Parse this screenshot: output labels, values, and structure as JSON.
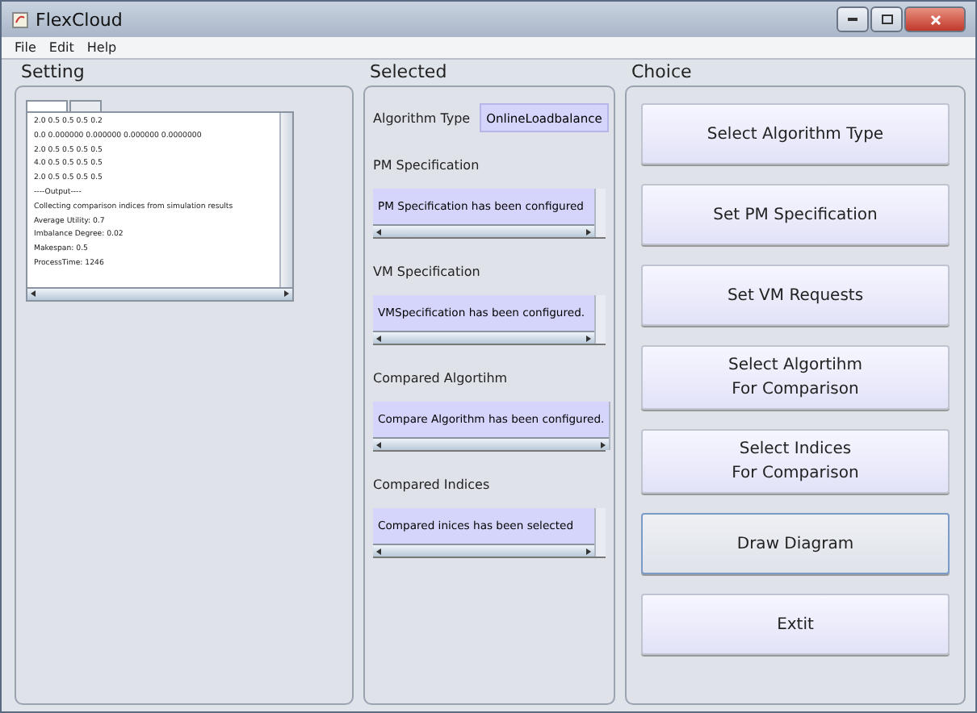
{
  "window": {
    "title": "FlexCloud"
  },
  "menu": [
    "File",
    "Edit",
    "Help"
  ],
  "setting": {
    "heading": "Setting",
    "tabs": [
      {
        "selected": true
      },
      {
        "selected": false
      }
    ],
    "log": [
      "2.0 0.5 0.5 0.5 0.2",
      "0.0 0.000000 0.000000 0.000000 0.0000000",
      "2.0 0.5 0.5 0.5 0.5",
      "4.0 0.5 0.5 0.5 0.5",
      "2.0 0.5 0.5 0.5 0.5",
      "----Output----",
      "Collecting comparison indices from simulation results",
      "Average Utility: 0.7",
      "Imbalance Degree: 0.02",
      "Makespan: 0.5",
      "ProcessTime: 1246"
    ]
  },
  "selected": {
    "heading": "Selected",
    "algorithm_type": {
      "label": "Algorithm Type",
      "value": "OnlineLoadbalance"
    },
    "sections": [
      {
        "label": "PM Specification",
        "text": "PM Specification has been configured"
      },
      {
        "label": "VM Specification",
        "text": "VMSpecification has been configured."
      },
      {
        "label": "Compared Algortihm",
        "text": "Compare Algorithm has been configured."
      },
      {
        "label": "Compared Indices",
        "text": "Compared inices has been selected"
      }
    ]
  },
  "choice": {
    "heading": "Choice",
    "buttons": [
      {
        "label": "Select Algorithm Type",
        "focused": false
      },
      {
        "label": "Set PM Specification",
        "focused": false
      },
      {
        "label": "Set VM Requests",
        "focused": false
      },
      {
        "label": "Select Algortihm\nFor Comparison",
        "focused": false
      },
      {
        "label": "Select Indices\nFor Comparison",
        "focused": false
      },
      {
        "label": "Draw Diagram",
        "focused": true
      },
      {
        "label": "Extit",
        "focused": false
      }
    ]
  }
}
